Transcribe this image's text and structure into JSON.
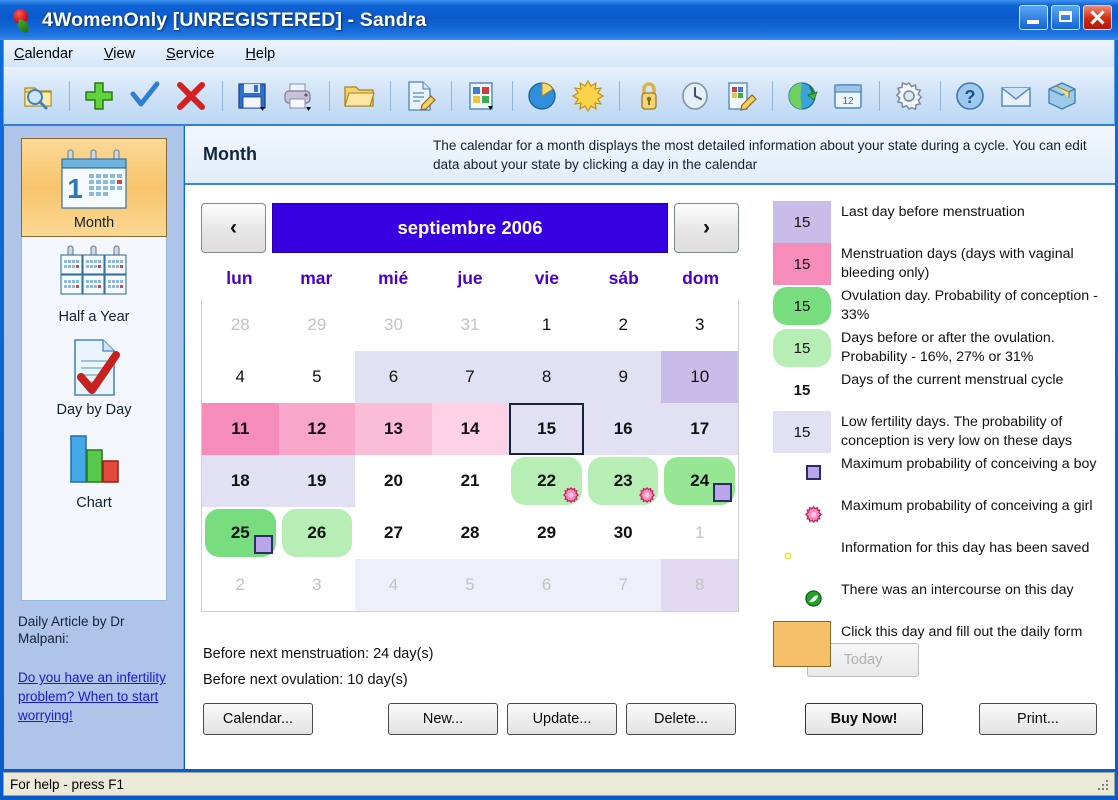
{
  "window": {
    "title": "4WomenOnly [UNREGISTERED] - Sandra",
    "app_icon": "tulip-icon",
    "minimize": "minimize-icon",
    "maximize": "maximize-icon",
    "close": "close-icon"
  },
  "menu": [
    {
      "label": "Calendar",
      "accel": "C"
    },
    {
      "label": "View",
      "accel": "V"
    },
    {
      "label": "Service",
      "accel": "S"
    },
    {
      "label": "Help",
      "accel": "H"
    }
  ],
  "toolbar": [
    {
      "name": "search-folder-icon"
    },
    {
      "sep": true
    },
    {
      "name": "add-icon"
    },
    {
      "name": "confirm-check-icon"
    },
    {
      "name": "delete-cross-icon"
    },
    {
      "sep": true
    },
    {
      "name": "save-icon"
    },
    {
      "name": "print-icon"
    },
    {
      "sep": true
    },
    {
      "name": "folder-icon"
    },
    {
      "sep": true
    },
    {
      "name": "edit-document-icon"
    },
    {
      "sep": true
    },
    {
      "name": "report-icon"
    },
    {
      "sep": true
    },
    {
      "name": "pie-chart-icon"
    },
    {
      "name": "sun-icon"
    },
    {
      "sep": true
    },
    {
      "name": "lock-icon"
    },
    {
      "name": "clock-icon"
    },
    {
      "name": "notes-edit-icon"
    },
    {
      "sep": true
    },
    {
      "name": "globe-refresh-icon"
    },
    {
      "name": "calendar-12-icon"
    },
    {
      "sep": true
    },
    {
      "name": "settings-gear-icon"
    },
    {
      "sep": true
    },
    {
      "name": "help-question-icon"
    },
    {
      "name": "mail-icon"
    },
    {
      "name": "package-icon"
    }
  ],
  "sidebar": {
    "items": [
      {
        "label": "Month",
        "icon": "calendar-month-icon",
        "selected": true
      },
      {
        "label": "Half a Year",
        "icon": "calendar-halfyear-icon",
        "selected": false
      },
      {
        "label": "Day by Day",
        "icon": "document-check-icon",
        "selected": false
      },
      {
        "label": "Chart",
        "icon": "bar-chart-icon",
        "selected": false
      }
    ],
    "article_title": "Daily Article by Dr Malpani:",
    "article_link": "Do you have an infertility problem? When to start worrying!"
  },
  "header": {
    "title": "Month",
    "description": "The calendar for a month displays the most detailed information about your state during a cycle. You can edit data about your state by clicking a day in the calendar"
  },
  "calendar": {
    "prev_label": "‹",
    "next_label": "›",
    "month_label": "septiembre 2006",
    "weekdays": [
      "lun",
      "mar",
      "mié",
      "jue",
      "vie",
      "sáb",
      "dom"
    ],
    "weeks": [
      [
        {
          "d": "28",
          "dim": true,
          "fill": "none"
        },
        {
          "d": "29",
          "dim": true,
          "fill": "none"
        },
        {
          "d": "30",
          "dim": true,
          "fill": "none"
        },
        {
          "d": "31",
          "dim": true,
          "fill": "none"
        },
        {
          "d": "1",
          "dim": false,
          "fill": "none"
        },
        {
          "d": "2",
          "dim": false,
          "fill": "none"
        },
        {
          "d": "3",
          "dim": false,
          "fill": "none"
        }
      ],
      [
        {
          "d": "4",
          "dim": false,
          "fill": "none"
        },
        {
          "d": "5",
          "dim": false,
          "fill": "none"
        },
        {
          "d": "6",
          "dim": false,
          "fill": "lowfert"
        },
        {
          "d": "7",
          "dim": false,
          "fill": "lowfert"
        },
        {
          "d": "8",
          "dim": false,
          "fill": "lowfert"
        },
        {
          "d": "9",
          "dim": false,
          "fill": "lowfert"
        },
        {
          "d": "10",
          "dim": false,
          "fill": "lastday"
        }
      ],
      [
        {
          "d": "11",
          "dim": false,
          "bold": true,
          "fill": "mens1"
        },
        {
          "d": "12",
          "dim": false,
          "bold": true,
          "fill": "mens2"
        },
        {
          "d": "13",
          "dim": false,
          "bold": true,
          "fill": "mens3"
        },
        {
          "d": "14",
          "dim": false,
          "bold": true,
          "fill": "mens4"
        },
        {
          "d": "15",
          "dim": false,
          "bold": true,
          "fill": "lowfert",
          "selected": true
        },
        {
          "d": "16",
          "dim": false,
          "bold": true,
          "fill": "lowfert"
        },
        {
          "d": "17",
          "dim": false,
          "bold": true,
          "fill": "lowfert"
        }
      ],
      [
        {
          "d": "18",
          "dim": false,
          "bold": true,
          "fill": "lowfert"
        },
        {
          "d": "19",
          "dim": false,
          "bold": true,
          "fill": "lowfert"
        },
        {
          "d": "20",
          "dim": false,
          "bold": true,
          "fill": "none"
        },
        {
          "d": "21",
          "dim": false,
          "bold": true,
          "fill": "none"
        },
        {
          "d": "22",
          "dim": false,
          "bold": true,
          "fill": "fertile",
          "badge": "girl"
        },
        {
          "d": "23",
          "dim": false,
          "bold": true,
          "fill": "fertile",
          "badge": "girl"
        },
        {
          "d": "24",
          "dim": false,
          "bold": true,
          "fill": "fertile2",
          "badge": "boy"
        }
      ],
      [
        {
          "d": "25",
          "dim": false,
          "bold": true,
          "fill": "ovulation",
          "badge": "boy"
        },
        {
          "d": "26",
          "dim": false,
          "bold": true,
          "fill": "fertile"
        },
        {
          "d": "27",
          "dim": false,
          "bold": true,
          "fill": "none"
        },
        {
          "d": "28",
          "dim": false,
          "bold": true,
          "fill": "none"
        },
        {
          "d": "29",
          "dim": false,
          "bold": true,
          "fill": "none"
        },
        {
          "d": "30",
          "dim": false,
          "bold": true,
          "fill": "none"
        },
        {
          "d": "1",
          "dim": true,
          "fill": "none"
        }
      ],
      [
        {
          "d": "2",
          "dim": true,
          "fill": "none"
        },
        {
          "d": "3",
          "dim": true,
          "fill": "none"
        },
        {
          "d": "4",
          "dim": true,
          "fill": "lowfert"
        },
        {
          "d": "5",
          "dim": true,
          "fill": "lowfert"
        },
        {
          "d": "6",
          "dim": true,
          "fill": "lowfert"
        },
        {
          "d": "7",
          "dim": true,
          "fill": "lowfert"
        },
        {
          "d": "8",
          "dim": true,
          "fill": "lastday"
        }
      ]
    ]
  },
  "status": {
    "before_menstruation": "Before next menstruation: 24 day(s)",
    "before_ovulation": "Before next ovulation: 10 day(s)",
    "today_button": "Today"
  },
  "buttons": {
    "calendar": "Calendar...",
    "new": "New...",
    "update": "Update...",
    "delete": "Delete...",
    "buy_now": "Buy Now!",
    "print": "Print..."
  },
  "legend": [
    {
      "sample": "15",
      "swatch": "lastday",
      "shape": "square",
      "text": "Last day before menstruation"
    },
    {
      "sample": "15",
      "swatch": "mens1",
      "shape": "square",
      "text": "Menstruation days (days with vaginal bleeding only)"
    },
    {
      "sample": "15",
      "swatch": "ovulation",
      "shape": "round",
      "text": "Ovulation day. Probability of conception - 33%"
    },
    {
      "sample": "15",
      "swatch": "fertile",
      "shape": "round",
      "text": "Days before or after the ovulation. Probability - 16%, 27% or 31%"
    },
    {
      "sample": "15",
      "swatch": "none",
      "shape": "bold",
      "text": "Days of the current menstrual cycle"
    },
    {
      "sample": "15",
      "swatch": "lowfert",
      "shape": "square",
      "text": "Low fertility days. The probability of conception is very low on these days"
    },
    {
      "sample": "",
      "swatch": "white",
      "shape": "boy",
      "text": "Maximum probability of conceiving a boy"
    },
    {
      "sample": "",
      "swatch": "white",
      "shape": "girl",
      "text": "Maximum probability of conceiving a girl"
    },
    {
      "sample": "",
      "swatch": "white",
      "shape": "saved",
      "text": "Information for this day has been saved"
    },
    {
      "sample": "",
      "swatch": "white",
      "shape": "sex",
      "text": "There was an intercourse on this day"
    },
    {
      "sample": "",
      "swatch": "clickday",
      "shape": "square",
      "text": "Click this day and fill out the daily form"
    }
  ],
  "statusbar": {
    "text": "For help - press F1"
  },
  "colors": {
    "lastday": "#c9bce8",
    "lowfert": "#e2e1f4",
    "mens1": "#f58cba",
    "mens2": "#f9a6cb",
    "mens3": "#fbbcd8",
    "mens4": "#fdd2e4",
    "ovulation": "#78dd7e",
    "fertile": "#b6eeb5",
    "fertile2": "#96e694",
    "clickday": "#f6c069",
    "month_bar": "#3700e0",
    "weekday": "#4b00c8",
    "link": "#1a1ad0"
  }
}
